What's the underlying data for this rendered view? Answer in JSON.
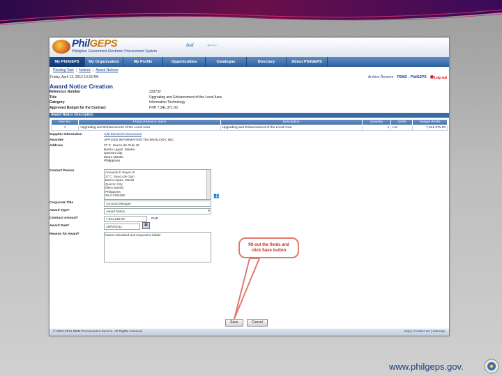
{
  "colors": {
    "nav": "#3b6ba6",
    "brand": "#1b3f8f",
    "accent_red": "#c42a1a",
    "slide_bg": "#bdbdbd"
  },
  "app": {
    "brand_main": "Phil",
    "brand_geps": "GEPS",
    "brand_sub": "Philippine Government Electronic Procurement System",
    "bid_label": "bid",
    "logo_icon": "philgeps-logo"
  },
  "nav": {
    "tabs": [
      {
        "label": "My PhilGEPS",
        "active": true
      },
      {
        "label": "My Organization",
        "active": false
      },
      {
        "label": "My Profile",
        "active": false
      },
      {
        "label": "Opportunities",
        "active": false
      },
      {
        "label": "Catalogue",
        "active": false
      },
      {
        "label": "Directory",
        "active": false
      },
      {
        "label": "About PhilGEPS",
        "active": false
      }
    ]
  },
  "subnav": {
    "items": [
      "Pending Task",
      "Notices",
      "Award Notices"
    ],
    "date": "Friday, April 13, 2012 10:23 AM",
    "archive": "Archive Reserve",
    "org": "PSMO - PhilGEPS",
    "logout": "Log out"
  },
  "page": {
    "title": "Award Notice Creation"
  },
  "info": {
    "rows": [
      {
        "label": "Reference Number",
        "value": "233732"
      },
      {
        "label": "Title",
        "value": "Upgrading and Enhancement of the Local Area"
      },
      {
        "label": "Category",
        "value": "Information Technology"
      },
      {
        "label": "Approved Budget for the Contract",
        "value": "PHP 7,341,371.00"
      }
    ]
  },
  "section": {
    "title": "Award Notice Description"
  },
  "items_table": {
    "headers": [
      "Item No.",
      "Product/Service Name",
      "Description",
      "Quantity",
      "UOM",
      "Budget (PHP)"
    ],
    "rows": [
      [
        "1",
        "Upgrading and Enhancement of the Local Area",
        "Upgrading and Enhancement of the Local Area",
        "1",
        "Lot",
        "7,341,371.00"
      ]
    ]
  },
  "form": {
    "supplier_info_label": "Supplier Information",
    "add_document_link": "Add Electronic Document",
    "awardee_label": "Awardee",
    "awardee_value": "APPLIED INFORMATION TECHNOLOGY, INC.",
    "address_label": "Address",
    "address_lines": [
      "27 C. Sauco de Gulo St.",
      "Barrio Lapaz, Manila",
      "Quezon City",
      "Metro Manila",
      "Philippines"
    ],
    "contact_label": "Contact Person",
    "contact_lines": [
      "Armando P. Reyes III",
      "27 C. Sauco de Gulo",
      "Barrio Lapaz, Manila",
      "Quezon City",
      "Metro Manila",
      "Philippines",
      "09-2-3795399"
    ],
    "contact_icon": "people-icon",
    "corporate_title_label": "Corporate Title",
    "corporate_title_value": "Account Manager",
    "award_type_label": "Award Type*",
    "award_type_value": "Award Notice",
    "contract_amount_label": "Contract Amount*",
    "contract_amount_value": "7,341,250.00",
    "currency": "PHP",
    "award_date_label": "Award Date*",
    "award_date_value": "19/04/2012",
    "calendar_icon": "calendar-icon",
    "reason_label": "Reason for Award*",
    "reason_value": "lowest calculated and responsive bidder"
  },
  "callout": {
    "line1": "fill-out the fields and",
    "line2": "click Save button"
  },
  "buttons": {
    "save": "Save",
    "cancel": "Cancel"
  },
  "footer": {
    "copyright": "© 2004-2011 DBM Procurement Service. All Rights reserved",
    "links": "Help | Contact Us | Sitemap"
  },
  "slide": {
    "url": "www.philgeps.gov."
  }
}
